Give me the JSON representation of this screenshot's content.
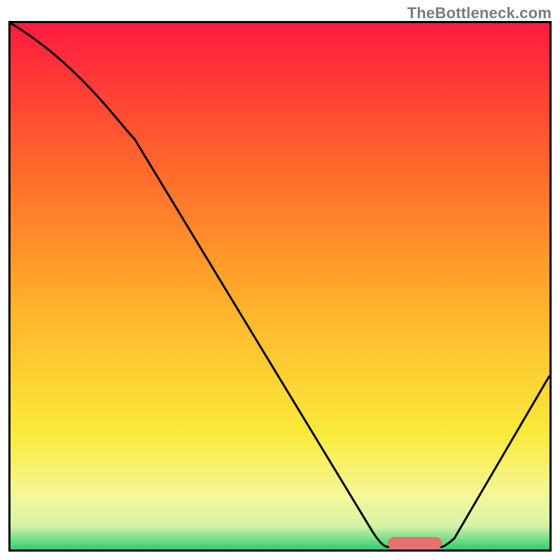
{
  "watermark": "TheBottleneck.com",
  "colors": {
    "top": "#ff1b3f",
    "mid1": "#ff6a2b",
    "mid2": "#ffb52a",
    "mid3": "#faea3b",
    "low1": "#f4f79a",
    "low2": "#d7f2a7",
    "bottom": "#2ecf73",
    "line": "#000000",
    "marker": "#e76f6f",
    "frame": "#000000"
  },
  "chart_data": {
    "type": "line",
    "title": "",
    "xlabel": "",
    "ylabel": "",
    "xlim": [
      0,
      100
    ],
    "ylim": [
      0,
      100
    ],
    "x": [
      0,
      23,
      70,
      80,
      100
    ],
    "values": [
      100,
      78,
      0.5,
      0.5,
      33
    ],
    "marker": {
      "x_start": 70,
      "x_end": 80,
      "y": 1.2
    },
    "gradient_stops": [
      {
        "pos": 0.0,
        "color": "#ff1b3f"
      },
      {
        "pos": 0.28,
        "color": "#ff6a2b"
      },
      {
        "pos": 0.55,
        "color": "#ffb52a"
      },
      {
        "pos": 0.78,
        "color": "#faea3b"
      },
      {
        "pos": 0.9,
        "color": "#f4f79a"
      },
      {
        "pos": 0.955,
        "color": "#d7f2a7"
      },
      {
        "pos": 1.0,
        "color": "#2ecf73"
      }
    ]
  }
}
